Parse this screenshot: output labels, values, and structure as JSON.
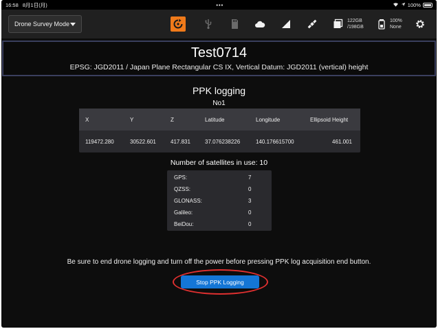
{
  "status_bar": {
    "time": "16:58",
    "date": "8月1日(月)",
    "dots": "•••",
    "battery": "100%"
  },
  "toolbar": {
    "mode_select": "Drone Survey Mode",
    "icons": [
      "sync-icon",
      "usb-icon",
      "sd-card-icon",
      "cloud-icon",
      "signal-icon",
      "satellite-icon",
      "storage-icon",
      "receiver-battery-icon",
      "gear-icon"
    ],
    "storage_used": "122GB",
    "storage_total": "/198GB",
    "receiver_battery": "100%",
    "receiver_status": "None",
    "accent_color": "#f07a1a"
  },
  "project": {
    "title": "Test0714",
    "crs": "EPSG: JGD2011 / Japan Plane Rectangular CS IX, Vertical Datum: JGD2011 (vertical) height"
  },
  "ppk": {
    "title": "PPK logging",
    "number": "No1",
    "columns": [
      "X",
      "Y",
      "Z",
      "Latitude",
      "Longitude",
      "Ellipsoid Height"
    ],
    "values": [
      "119472.280",
      "30522.601",
      "417.831",
      "37.076238226",
      "140.176615700",
      "461.001"
    ]
  },
  "satellites": {
    "title": "Number of satellites in use: 10",
    "rows": [
      {
        "name": "GPS:",
        "count": "7"
      },
      {
        "name": "QZSS:",
        "count": "0"
      },
      {
        "name": "GLONASS:",
        "count": "3"
      },
      {
        "name": "Galileo:",
        "count": "0"
      },
      {
        "name": "BeiDou:",
        "count": "0"
      }
    ]
  },
  "warning": "Be sure to end drone logging and turn off the power before pressing PPK log acquisition end button.",
  "stop_button": {
    "label": "Stop PPK Logging",
    "color": "#1476d6"
  },
  "highlight_color": "#e03030"
}
